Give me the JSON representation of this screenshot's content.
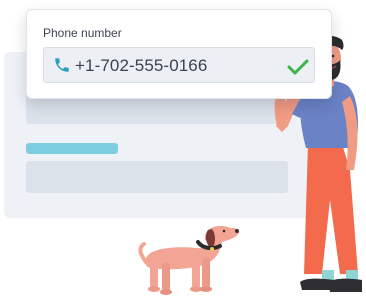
{
  "phone_field": {
    "label": "Phone number",
    "value": "+1-702-555-0166",
    "status": "valid"
  },
  "icons": {
    "phone": "phone-icon",
    "check": "check-icon"
  },
  "colors": {
    "accent": "#7dcede",
    "phone_icon": "#2aa0bf",
    "check": "#3cb44b",
    "panel": "#eef2f7",
    "bar": "#dce2ea"
  },
  "illustration": {
    "person": "man-holding-phone",
    "dog": "dachshund"
  }
}
